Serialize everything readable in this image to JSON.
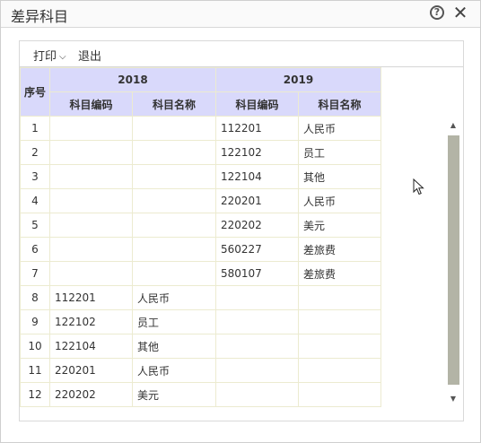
{
  "window": {
    "title": "差异科目",
    "help_icon_text": "?",
    "close_icon_text": "✕"
  },
  "toolbar": {
    "print_label": "打印",
    "exit_label": "退出"
  },
  "table": {
    "seq_header": "序号",
    "year_a": "2018",
    "year_b": "2019",
    "code_header": "科目编码",
    "name_header": "科目名称",
    "rows": [
      {
        "seq": "1",
        "code_a": "",
        "name_a": "",
        "code_b": "112201",
        "name_b": "人民币"
      },
      {
        "seq": "2",
        "code_a": "",
        "name_a": "",
        "code_b": "122102",
        "name_b": "员工"
      },
      {
        "seq": "3",
        "code_a": "",
        "name_a": "",
        "code_b": "122104",
        "name_b": "其他"
      },
      {
        "seq": "4",
        "code_a": "",
        "name_a": "",
        "code_b": "220201",
        "name_b": "人民币"
      },
      {
        "seq": "5",
        "code_a": "",
        "name_a": "",
        "code_b": "220202",
        "name_b": "美元"
      },
      {
        "seq": "6",
        "code_a": "",
        "name_a": "",
        "code_b": "560227",
        "name_b": "差旅费"
      },
      {
        "seq": "7",
        "code_a": "",
        "name_a": "",
        "code_b": "580107",
        "name_b": "差旅费"
      },
      {
        "seq": "8",
        "code_a": "112201",
        "name_a": "人民币",
        "code_b": "",
        "name_b": ""
      },
      {
        "seq": "9",
        "code_a": "122102",
        "name_a": "员工",
        "code_b": "",
        "name_b": ""
      },
      {
        "seq": "10",
        "code_a": "122104",
        "name_a": "其他",
        "code_b": "",
        "name_b": ""
      },
      {
        "seq": "11",
        "code_a": "220201",
        "name_a": "人民币",
        "code_b": "",
        "name_b": ""
      },
      {
        "seq": "12",
        "code_a": "220202",
        "name_a": "美元",
        "code_b": "",
        "name_b": ""
      }
    ]
  },
  "colors": {
    "header_bg": "#d9d9fb",
    "grid_line": "#ecebd0",
    "scroll_thumb": "#b3b4a6"
  }
}
